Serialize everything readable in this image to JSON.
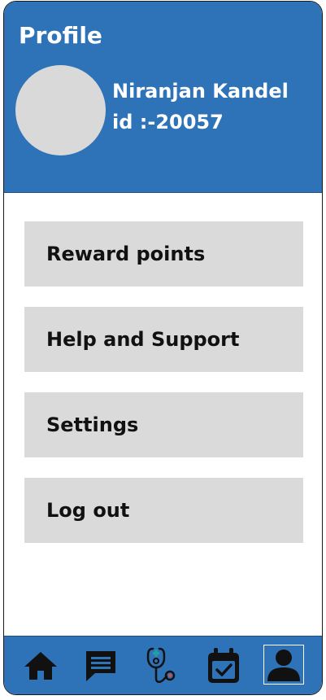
{
  "header": {
    "title": "Profile",
    "user_name": "Niranjan Kandel",
    "user_id": "id :-20057"
  },
  "menu": {
    "items": [
      {
        "label": "Reward points"
      },
      {
        "label": "Help and Support"
      },
      {
        "label": "Settings"
      },
      {
        "label": "Log out"
      }
    ]
  },
  "bottom_nav": {
    "items": [
      {
        "icon": "home-icon"
      },
      {
        "icon": "chat-icon"
      },
      {
        "icon": "stethoscope-icon"
      },
      {
        "icon": "calendar-check-icon"
      },
      {
        "icon": "user-icon",
        "active": true
      }
    ]
  },
  "colors": {
    "brand_blue": "#2e73b8",
    "menu_gray": "#dadada",
    "avatar_gray": "#d9d9d9",
    "icon_dark": "#111111",
    "accent_teal": "#1fa3a0",
    "accent_red": "#d94a4a"
  }
}
